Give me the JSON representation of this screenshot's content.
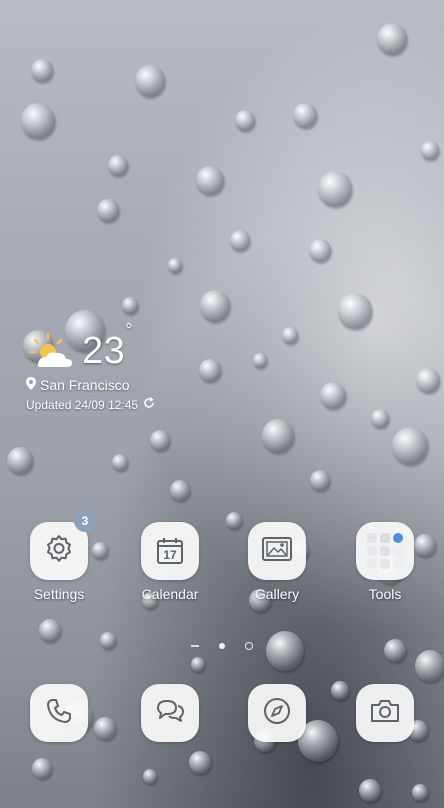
{
  "weather": {
    "temperature": "23",
    "unit": "°",
    "location": "San Francisco",
    "updated": "Updated 24/09 12:45",
    "icon": "partly-sunny-icon"
  },
  "apps": [
    {
      "label": "Settings",
      "icon": "gear-icon",
      "badge": "3"
    },
    {
      "label": "Calendar",
      "icon": "calendar-icon",
      "day": "17"
    },
    {
      "label": "Gallery",
      "icon": "image-icon"
    },
    {
      "label": "Tools",
      "icon": "folder-icon"
    }
  ],
  "dock": [
    {
      "icon": "phone-icon"
    },
    {
      "icon": "messages-icon"
    },
    {
      "icon": "compass-icon"
    },
    {
      "icon": "camera-icon"
    }
  ],
  "colors": {
    "badge": "#8fa0bd",
    "icon_stroke": "#5f636a"
  }
}
